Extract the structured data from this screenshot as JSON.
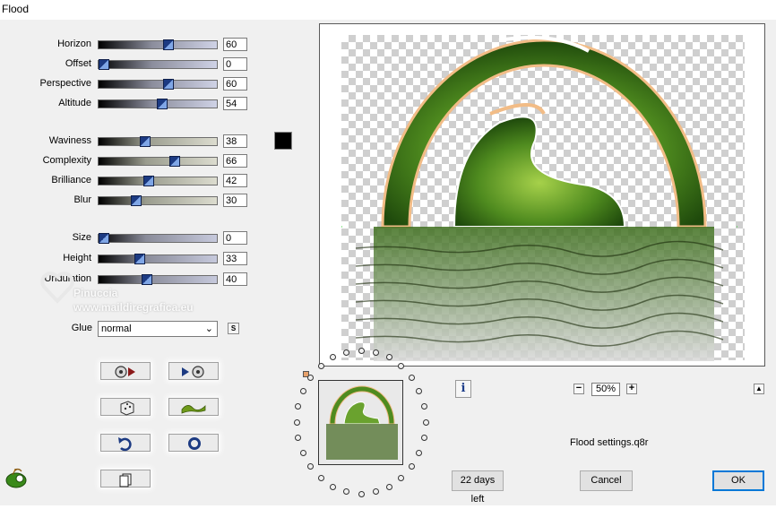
{
  "window": {
    "title": "Flood"
  },
  "sliders": [
    {
      "label": "Horizon",
      "value": "60",
      "pos": 0.6,
      "style": "top"
    },
    {
      "label": "Offset",
      "value": "0",
      "pos": 0.0,
      "style": "top"
    },
    {
      "label": "Perspective",
      "value": "60",
      "pos": 0.6,
      "style": "top"
    },
    {
      "label": "Altitude",
      "value": "54",
      "pos": 0.54,
      "style": "top"
    },
    {
      "label": "Waviness",
      "value": "38",
      "pos": 0.38,
      "style": "mid"
    },
    {
      "label": "Complexity",
      "value": "66",
      "pos": 0.66,
      "style": "mid"
    },
    {
      "label": "Brilliance",
      "value": "42",
      "pos": 0.42,
      "style": "mid"
    },
    {
      "label": "Blur",
      "value": "30",
      "pos": 0.3,
      "style": "mid"
    },
    {
      "label": "Size",
      "value": "0",
      "pos": 0.0,
      "style": "bot"
    },
    {
      "label": "Height",
      "value": "33",
      "pos": 0.33,
      "style": "bot"
    },
    {
      "label": "Undulation",
      "value": "40",
      "pos": 0.4,
      "style": "bot"
    }
  ],
  "glue": {
    "label": "Glue",
    "value": "normal",
    "s_button": "S"
  },
  "color_swatch": "#000000",
  "watermark": {
    "line1": "Pinuccia",
    "line2": "www.maildiregrafica.eu"
  },
  "tool_buttons": [
    {
      "name": "load-preset-button",
      "icon": "disc-arrow-out-icon"
    },
    {
      "name": "save-preset-button",
      "icon": "arrow-disc-in-icon"
    },
    {
      "name": "random-button",
      "icon": "dice-icon"
    },
    {
      "name": "wave-button",
      "icon": "wave-icon"
    },
    {
      "name": "undo-button",
      "icon": "undo-arrow-icon"
    },
    {
      "name": "reset-button",
      "icon": "ring-icon"
    },
    {
      "name": "copy-button",
      "icon": "copy-pages-icon"
    }
  ],
  "preview": {
    "zoom": "50%"
  },
  "info_button": "i",
  "settings_file": "Flood settings.q8r",
  "buttons": {
    "days_left": "22 days left",
    "cancel": "Cancel",
    "ok": "OK"
  },
  "colors": {
    "accent": "#0078d7",
    "thumb_dark": "#1c3a82",
    "thumb_light": "#7fa6e6",
    "orange": "#e6a06a"
  }
}
